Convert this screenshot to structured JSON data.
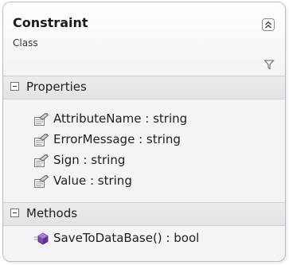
{
  "class_shape": {
    "title": "Constraint",
    "subtitle": "Class",
    "collapse_icon": "double-chevron-up-icon",
    "filter_icon": "filter-icon"
  },
  "compartments": {
    "properties": {
      "label": "Properties",
      "items": [
        {
          "text": "AttributeName : string",
          "icon": "property-icon"
        },
        {
          "text": "ErrorMessage : string",
          "icon": "property-icon"
        },
        {
          "text": "Sign : string",
          "icon": "property-icon"
        },
        {
          "text": "Value : string",
          "icon": "property-icon"
        }
      ]
    },
    "methods": {
      "label": "Methods",
      "items": [
        {
          "text": "SaveToDataBase() : bool",
          "icon": "method-icon"
        }
      ]
    }
  },
  "colors": {
    "border": "#b9bdc3",
    "compartment_header": "#e4e5e8",
    "method_icon": "#6b3fa0"
  }
}
